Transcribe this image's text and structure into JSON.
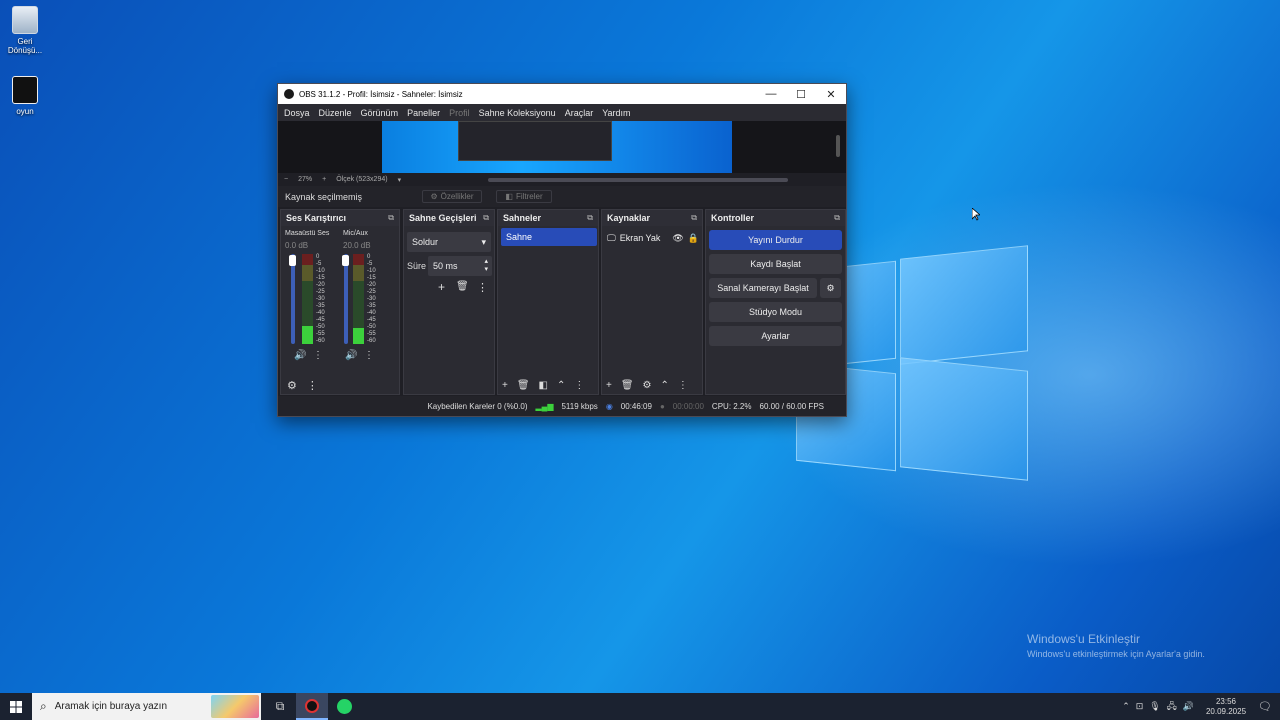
{
  "desktop": {
    "icons": [
      {
        "label": "Geri Dönüşü..."
      },
      {
        "label": "oyun"
      }
    ],
    "activation": {
      "title": "Windows'u Etkinleştir",
      "subtitle": "Windows'u etkinleştirmek için Ayarlar'a gidin."
    }
  },
  "obs": {
    "title": "OBS 31.1.2 - Profil: İsimsiz - Sahneler: İsimsiz",
    "menu": [
      "Dosya",
      "Düzenle",
      "Görünüm",
      "Paneller",
      "Profil",
      "Sahne Koleksiyonu",
      "Araçlar",
      "Yardım"
    ],
    "zoom": {
      "minus": "−",
      "value": "27%",
      "plus": "+",
      "scale": "Ölçek (523x294)"
    },
    "source_bar": {
      "status": "Kaynak seçilmemiş",
      "properties": "Özellikler",
      "filters": "Filtreler"
    },
    "mixer": {
      "title": "Ses Karıştırıcı",
      "channels": [
        {
          "name": "Masaüstü Ses",
          "db": "0.0 dB"
        },
        {
          "name": "Mic/Aux",
          "db": "20.0 dB"
        }
      ],
      "scale": [
        "0",
        "-5",
        "-10",
        "-15",
        "-20",
        "-25",
        "-30",
        "-35",
        "-40",
        "-45",
        "-50",
        "-55",
        "-60"
      ]
    },
    "transitions": {
      "title": "Sahne Geçişleri",
      "selected": "Soldur",
      "duration_label": "Süre",
      "duration": "50 ms"
    },
    "scenes": {
      "title": "Sahneler",
      "items": [
        "Sahne"
      ]
    },
    "sources": {
      "title": "Kaynaklar",
      "items": [
        "Ekran Yak"
      ]
    },
    "controls": {
      "title": "Kontroller",
      "buttons": [
        "Yayını Durdur",
        "Kaydı Başlat",
        "Sanal Kamerayı Başlat",
        "Stüdyo Modu",
        "Ayarlar"
      ]
    },
    "status": {
      "dropped": "Kaybedilen Kareler 0 (%0.0)",
      "bitrate": "5119 kbps",
      "stream_time": "00:46:09",
      "rec_time": "00:00:00",
      "cpu": "CPU: 2.2%",
      "fps": "60.00 / 60.00 FPS"
    }
  },
  "taskbar": {
    "search_placeholder": "Aramak için buraya yazın",
    "time": "23:56",
    "date": "20.09.2025"
  }
}
